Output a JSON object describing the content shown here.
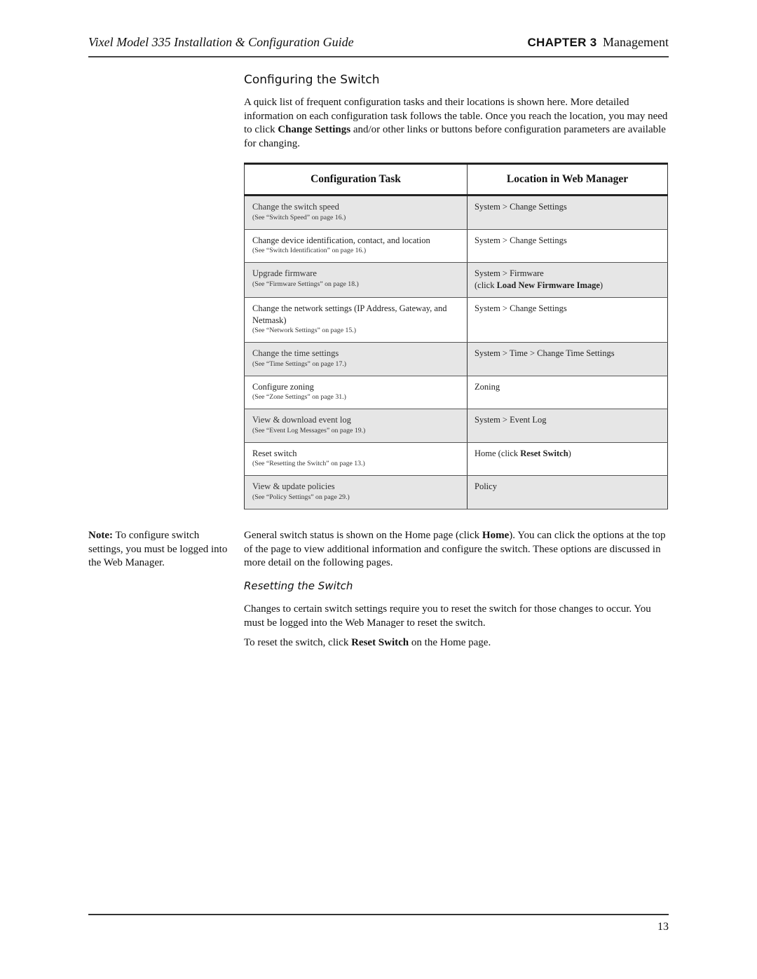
{
  "header": {
    "guide_title": "Vixel Model 335 Installation & Configuration Guide",
    "chapter_label": "CHAPTER 3",
    "chapter_name": "Management"
  },
  "section": {
    "title": "Configuring the Switch",
    "intro_parts": [
      "A quick list of frequent configuration tasks and their locations is shown here. More detailed information on each configuration task follows the table. Once you reach the location, you may need to click ",
      "Change Settings",
      " and/or other links or buttons before configuration parameters are available for changing."
    ]
  },
  "table": {
    "headers": [
      "Configuration Task",
      "Location in Web Manager"
    ],
    "rows": [
      {
        "task": "Change the switch speed",
        "ref": "(See “Switch Speed” on page 16.)",
        "location": "System > Change Settings",
        "location_bold": "",
        "location_suffix": "",
        "location_line2_prefix": "",
        "shaded": true
      },
      {
        "task": "Change device identification, contact, and location",
        "ref": "(See “Switch Identification” on page 16.)",
        "location": "System > Change Settings",
        "location_bold": "",
        "location_suffix": "",
        "location_line2_prefix": "",
        "shaded": false
      },
      {
        "task": "Upgrade firmware",
        "ref": "(See “Firmware Settings” on page 18.)",
        "location": "System > Firmware",
        "location_line2_prefix": "(click ",
        "location_bold": "Load New Firmware Image",
        "location_suffix": ")",
        "shaded": true
      },
      {
        "task": "Change the network settings (IP Address, Gateway, and Netmask)",
        "ref": "(See “Network Settings” on page 15.)",
        "location": "System > Change Settings",
        "location_bold": "",
        "location_suffix": "",
        "location_line2_prefix": "",
        "shaded": false
      },
      {
        "task": "Change the time settings",
        "ref": "(See “Time Settings” on page 17.)",
        "location": "System > Time > Change Time Settings",
        "location_bold": "",
        "location_suffix": "",
        "location_line2_prefix": "",
        "shaded": true
      },
      {
        "task": "Configure zoning",
        "ref": "(See “Zone Settings” on page 31.)",
        "location": "Zoning",
        "location_bold": "",
        "location_suffix": "",
        "location_line2_prefix": "",
        "shaded": false
      },
      {
        "task": "View & download event log",
        "ref": "(See “Event Log Messages” on page 19.)",
        "location": "System > Event Log",
        "location_bold": "",
        "location_suffix": "",
        "location_line2_prefix": "",
        "shaded": true
      },
      {
        "task": "Reset switch",
        "ref": "(See “Resetting the Switch” on page 13.)",
        "location": "Home (click ",
        "location_bold": "Reset Switch",
        "location_suffix": ")",
        "location_line2_prefix": "",
        "shaded": false
      },
      {
        "task": "View & update policies",
        "ref": "(See “Policy Settings” on page 29.)",
        "location": "Policy",
        "location_bold": "",
        "location_suffix": "",
        "location_line2_prefix": "",
        "shaded": true
      }
    ]
  },
  "note": {
    "label": "Note:",
    "text": " To configure switch settings, you must be logged into the Web Manager."
  },
  "general_parts": [
    "General switch status is shown on the Home page (click ",
    "Home",
    "). You can click the options at the top of the page to view additional information and configure the switch. These options are discussed in more detail on the following pages."
  ],
  "resetting": {
    "title": "Resetting the Switch",
    "para1": "Changes to certain switch settings require you to reset the switch for those changes to occur. You must be logged into the Web Manager to reset the switch.",
    "para2_parts": [
      "To reset the switch, click ",
      "Reset Switch",
      " on the Home page."
    ]
  },
  "footer": {
    "page_number": "13"
  }
}
